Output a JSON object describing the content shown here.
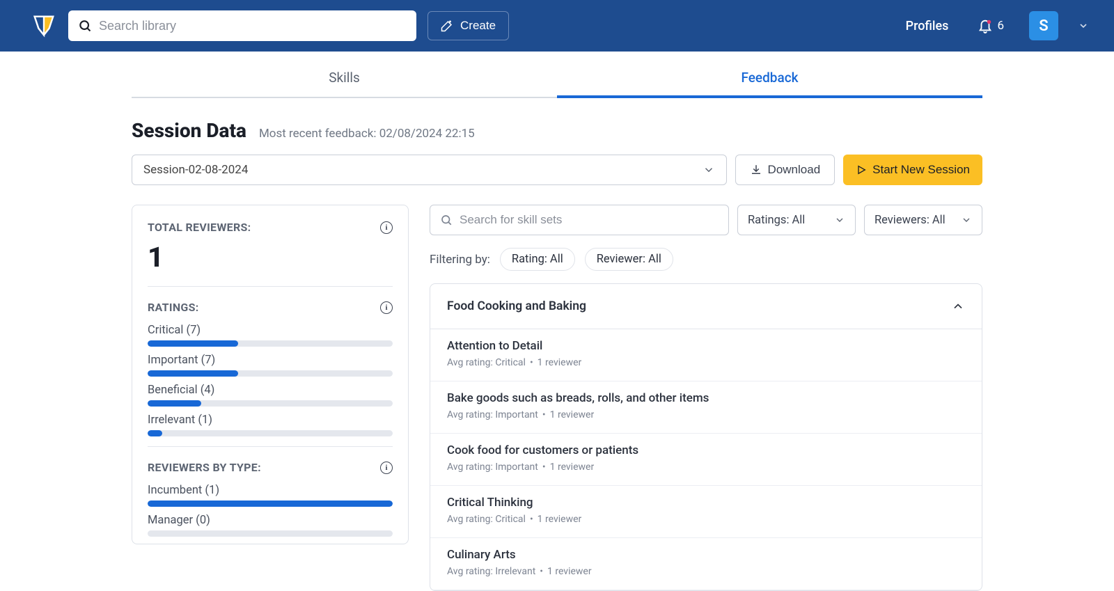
{
  "header": {
    "search_placeholder": "Search library",
    "create_label": "Create",
    "profiles_label": "Profiles",
    "notif_count": "6",
    "avatar_initial": "S"
  },
  "tabs": {
    "skills": "Skills",
    "feedback": "Feedback"
  },
  "title": "Session Data",
  "subtitle": "Most recent feedback: 02/08/2024 22:15",
  "session_selected": "Session-02-08-2024",
  "download_label": "Download",
  "new_session_label": "Start New Session",
  "sidebar": {
    "total_label": "TOTAL REVIEWERS:",
    "total_value": "1",
    "ratings_label": "RATINGS:",
    "ratings": [
      {
        "label": "Critical (7)",
        "pct": 37
      },
      {
        "label": "Important (7)",
        "pct": 37
      },
      {
        "label": "Beneficial (4)",
        "pct": 22
      },
      {
        "label": "Irrelevant (1)",
        "pct": 6
      }
    ],
    "type_label": "REVIEWERS BY TYPE:",
    "types": [
      {
        "label": "Incumbent (1)",
        "pct": 100
      },
      {
        "label": "Manager (0)",
        "pct": 0
      }
    ]
  },
  "filters": {
    "skill_search_placeholder": "Search for skill sets",
    "ratings_select": "Ratings: All",
    "reviewers_select": "Reviewers: All",
    "filtering_label": "Filtering by:",
    "pill_rating": "Rating: All",
    "pill_reviewer": "Reviewer: All"
  },
  "group": {
    "title": "Food Cooking and Baking",
    "items": [
      {
        "title": "Attention to Detail",
        "meta1": "Avg rating: Critical",
        "meta2": "1 reviewer"
      },
      {
        "title": "Bake goods such as breads, rolls, and other items",
        "meta1": "Avg rating: Important",
        "meta2": "1 reviewer"
      },
      {
        "title": "Cook food for customers or patients",
        "meta1": "Avg rating: Important",
        "meta2": "1 reviewer"
      },
      {
        "title": "Critical Thinking",
        "meta1": "Avg rating: Critical",
        "meta2": "1 reviewer"
      },
      {
        "title": "Culinary Arts",
        "meta1": "Avg rating: Irrelevant",
        "meta2": "1 reviewer"
      }
    ]
  }
}
